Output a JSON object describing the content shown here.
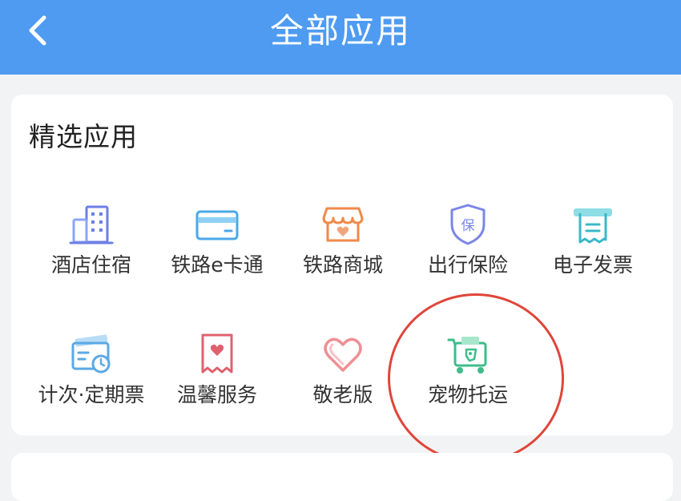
{
  "header": {
    "title": "全部应用"
  },
  "section": {
    "title": "精选应用"
  },
  "apps": [
    {
      "label": "酒店住宿",
      "icon": "hotel-building-icon"
    },
    {
      "label": "铁路e卡通",
      "icon": "railway-card-icon"
    },
    {
      "label": "铁路商城",
      "icon": "railway-mall-shop-icon"
    },
    {
      "label": "出行保险",
      "icon": "travel-insurance-shield-icon"
    },
    {
      "label": "电子发票",
      "icon": "e-invoice-icon"
    },
    {
      "label": "计次·定期票",
      "icon": "periodic-ticket-icon"
    },
    {
      "label": "温馨服务",
      "icon": "warm-service-heart-icon"
    },
    {
      "label": "敬老版",
      "icon": "elderly-heart-icon"
    },
    {
      "label": "宠物托运",
      "icon": "pet-carrier-cart-icon"
    }
  ],
  "colors": {
    "header": "#4e9bf1",
    "highlight": "#e0453a"
  }
}
